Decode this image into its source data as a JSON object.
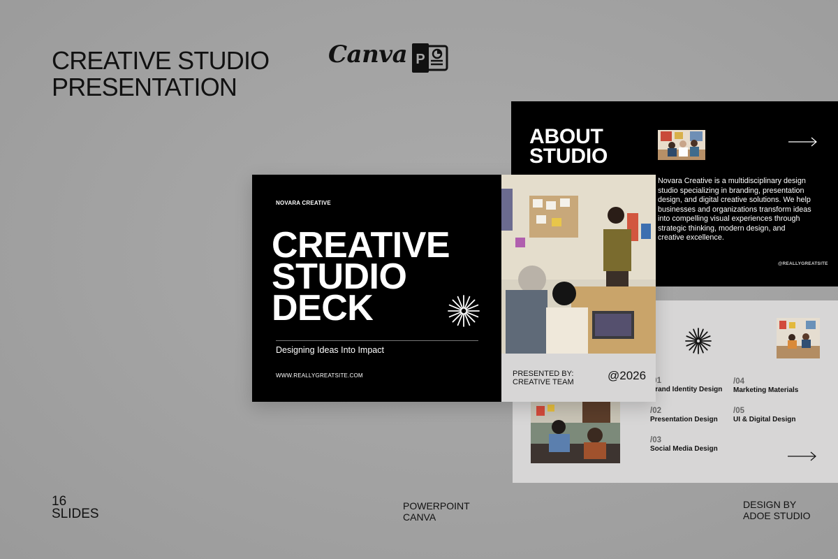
{
  "header": {
    "title": "CREATIVE STUDIO\nPRESENTATION",
    "canva_logo": "Canva",
    "powerpoint_icon": "powerpoint-icon"
  },
  "cover_slide": {
    "brand": "NOVARA CREATIVE",
    "title": "CREATIVE\nSTUDIO\nDECK",
    "tagline": "Designing Ideas Into Impact",
    "website": "WWW.REALLYGREATSITE.COM",
    "presented_by": "PRESENTED BY:\nCREATIVE TEAM",
    "year": "@2026"
  },
  "about_slide": {
    "title": "ABOUT\nSTUDIO",
    "description": "Novara Creative is a multidisciplinary design studio specializing in branding, presentation design, and digital creative solutions. We help businesses and organizations transform ideas into compelling visual experiences through strategic thinking, modern design, and creative excellence.",
    "handle": "@REALLYGREATSITE"
  },
  "services_slide": {
    "services": [
      {
        "num": "/01",
        "label": "Brand Identity Design"
      },
      {
        "num": "/02",
        "label": "Presentation Design"
      },
      {
        "num": "/03",
        "label": "Social Media Design"
      },
      {
        "num": "/04",
        "label": "Marketing Materials"
      },
      {
        "num": "/05",
        "label": "UI & Digital Design"
      }
    ]
  },
  "footer": {
    "slides_count": "16",
    "slides_label": "SLIDES",
    "platforms": "POWERPOINT\nCANVA",
    "designer": "DESIGN BY\nADOE STUDIO"
  },
  "colors": {
    "background": "#a5a5a5",
    "dark_slide": "#000000",
    "light_slide": "#d7d6d6",
    "text": "#111111"
  }
}
